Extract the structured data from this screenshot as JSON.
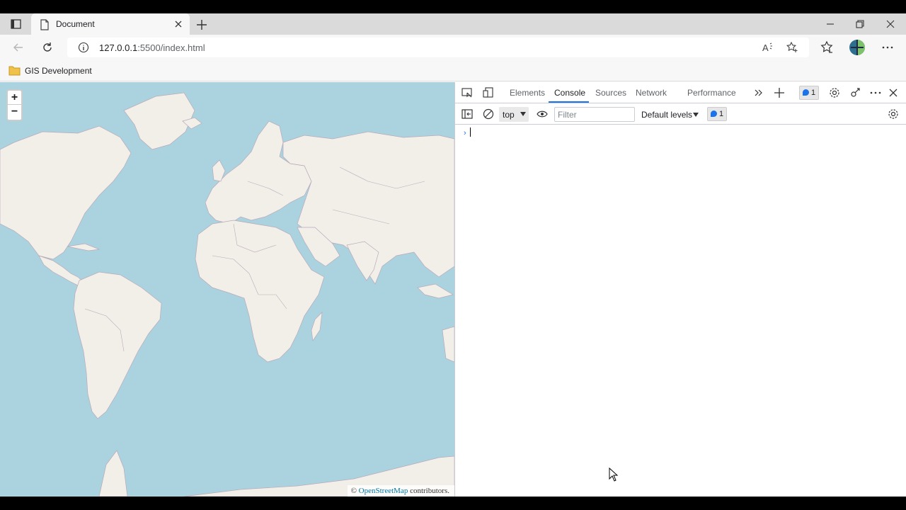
{
  "browser": {
    "tab": {
      "title": "Document"
    },
    "address": {
      "host": "127.0.0.1",
      "path": ":5500/index.html"
    },
    "favorites": [
      {
        "label": "GIS Development"
      }
    ]
  },
  "map": {
    "zoom_in_label": "+",
    "zoom_out_label": "−",
    "attribution": {
      "prefix": "© ",
      "link": "OpenStreetMap",
      "suffix": " contributors."
    },
    "colors": {
      "water": "#aad3df",
      "land": "#f2efe9",
      "border": "#b9a9b9"
    }
  },
  "devtools": {
    "tabs": [
      "Elements",
      "Console",
      "Sources",
      "Network",
      "Performance"
    ],
    "active_tab": "Console",
    "issues_count": "1",
    "console": {
      "context": "top",
      "filter_placeholder": "Filter",
      "levels": "Default levels",
      "message_count": "1",
      "prompt": "›"
    }
  }
}
